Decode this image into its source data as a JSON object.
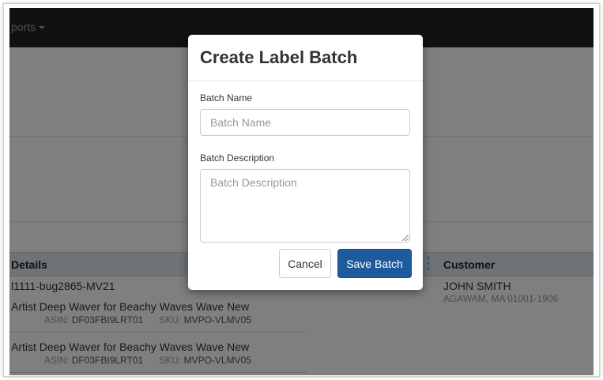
{
  "navbar": {
    "reports_label": "ports"
  },
  "table": {
    "header_details": "Details",
    "header_customer": "Customer",
    "order_id": "l1111-bug2865-MV21",
    "items": [
      {
        "title": "Artist Deep Waver for Beachy Waves Wave New",
        "asin_label": "ASIN:",
        "asin": "DF03FBI9LRT01",
        "sku_label": "SKU:",
        "sku": "MVPO-VLMV05"
      },
      {
        "title": "Artist Deep Waver for Beachy Waves Wave New",
        "asin_label": "ASIN:",
        "asin": "DF03FBI9LRT01",
        "sku_label": "SKU:",
        "sku": "MVPO-VLMV05"
      }
    ],
    "customer": {
      "name": "JOHN SMITH",
      "address": "AGAWAM, MA 01001-1906"
    }
  },
  "modal": {
    "title": "Create Label Batch",
    "batch_name_label": "Batch Name",
    "batch_name_placeholder": "Batch Name",
    "batch_name_value": "",
    "batch_description_label": "Batch Description",
    "batch_description_placeholder": "Batch Description",
    "batch_description_value": "",
    "cancel_label": "Cancel",
    "save_label": "Save Batch"
  },
  "colors": {
    "navbar": "#222222",
    "primary_button": "#1e5b9c",
    "table_header": "#dde6ef"
  }
}
